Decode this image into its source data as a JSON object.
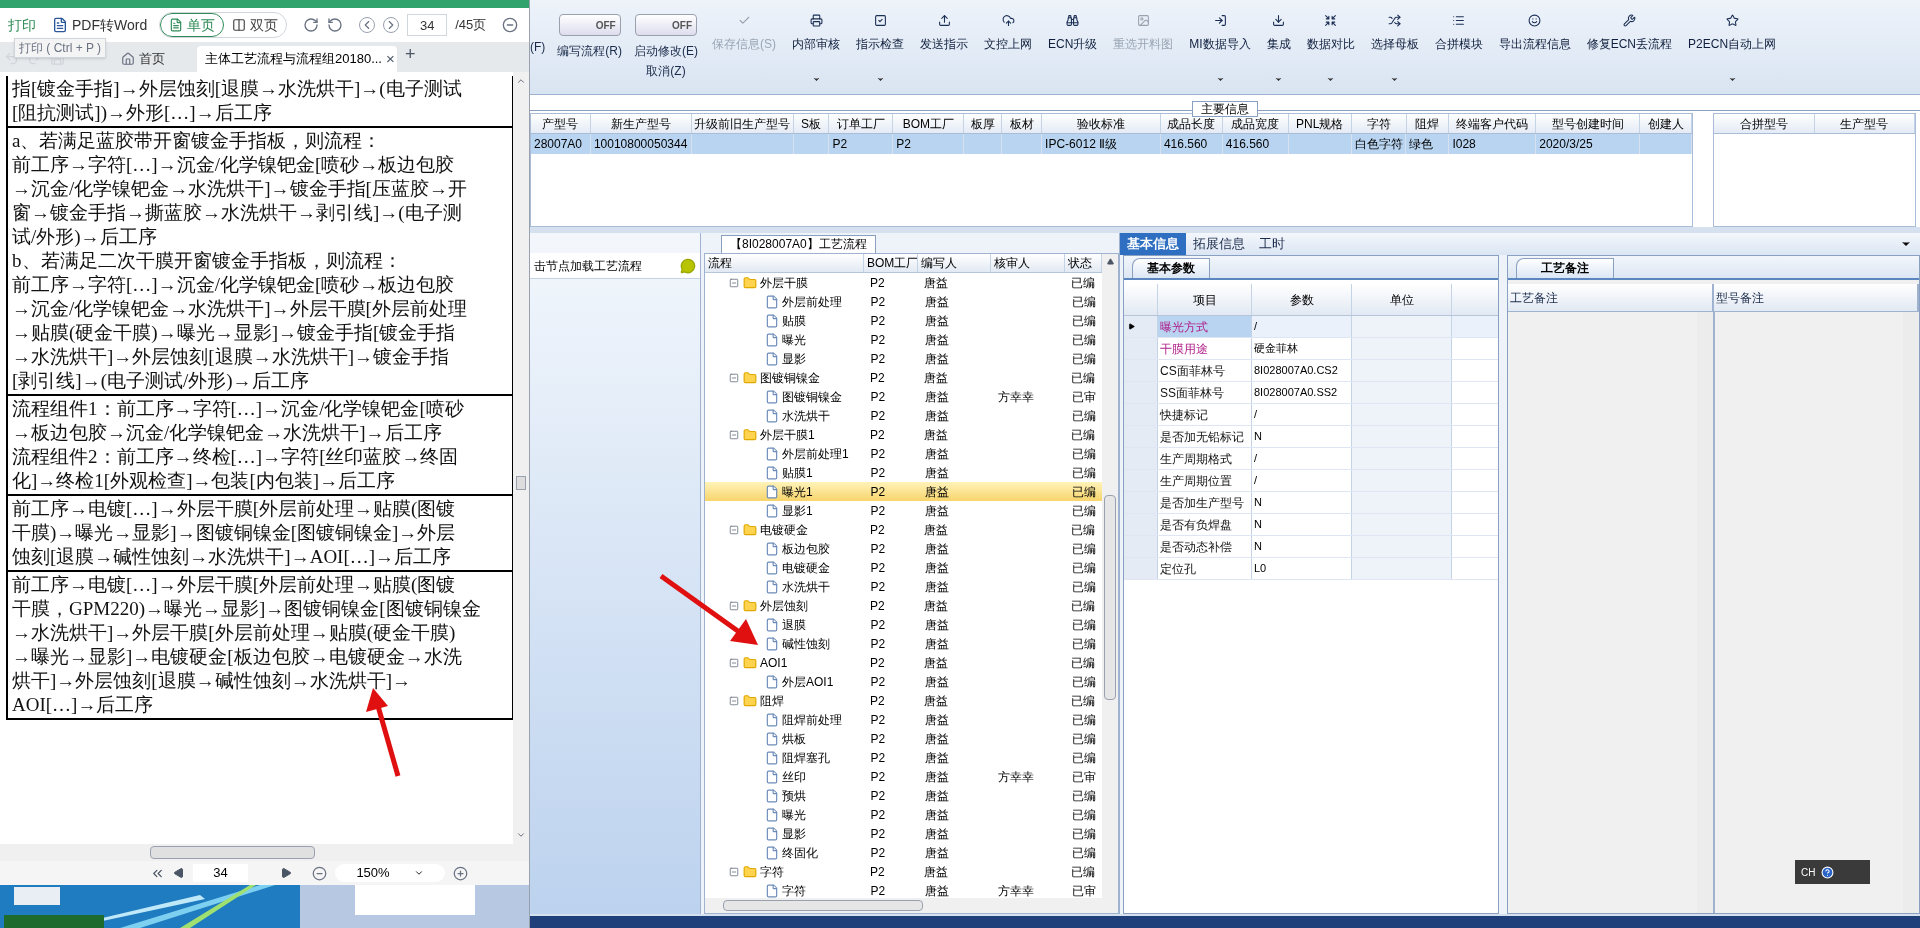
{
  "pdf_viewer": {
    "toolbar": {
      "print": "打印",
      "to_word": "PDF转Word",
      "view_modes": [
        {
          "label": "单页",
          "selected": true
        },
        {
          "label": "双页",
          "selected": false
        }
      ],
      "page": "34",
      "page_total": "/45页"
    },
    "tooltip": "打印 ( Ctrl + P )",
    "tabs": [
      {
        "label": "首页",
        "selected": false
      },
      {
        "label": "主体工艺流程与流程组20180...",
        "selected": true
      }
    ],
    "close_tab": "×",
    "new_tab": "+",
    "table_rows": [
      [
        "指[镀金手指]→外层蚀刻[退膜→水洗烘干]→(电子测试",
        "[阻抗测试])→外形[…]→后工序"
      ],
      [
        "a、若满足蓝胶带开窗镀金手指板，则流程：",
        "前工序→字符[…]→沉金/化学镍钯金[喷砂→板边包胶",
        "→沉金/化学镍钯金→水洗烘干]→镀金手指[压蓝胶→开",
        "窗→镀金手指→撕蓝胶→水洗烘干→剥引线]→(电子测",
        "试/外形)→后工序",
        "b、若满足二次干膜开窗镀金手指板，则流程：",
        "前工序→字符[…]→沉金/化学镍钯金[喷砂→板边包胶",
        "→沉金/化学镍钯金→水洗烘干]→外层干膜[外层前处理",
        "→贴膜(硬金干膜)→曝光→显影]→镀金手指[镀金手指",
        "→水洗烘干]→外层蚀刻[退膜→水洗烘干]→镀金手指",
        "[剥引线]→(电子测试/外形)→后工序"
      ],
      [
        "流程组件1：前工序→字符[…]→沉金/化学镍钯金[喷砂",
        "→板边包胶→沉金/化学镍钯金→水洗烘干]→后工序",
        "流程组件2：前工序→终检[…]→字符[丝印蓝胶→终固",
        "化]→终检1[外观检查]→包装[内包装]→后工序"
      ],
      [
        "前工序→电镀[…]→外层干膜[外层前处理→贴膜(图镀",
        "干膜)→曝光→显影]→图镀铜镍金[图镀铜镍金]→外层",
        "蚀刻[退膜→碱性蚀刻→水洗烘干]→AOI[…]→后工序"
      ],
      [
        "前工序→电镀[…]→外层干膜[外层前处理→贴膜(图镀",
        "干膜，GPM220)→曝光→显影]→图镀铜镍金[图镀铜镍金",
        "→水洗烘干]→外层干膜[外层前处理→贴膜(硬金干膜)",
        "→曝光→显影]→电镀硬金[板边包胶→电镀硬金→水洗",
        "烘干]→外层蚀刻[退膜→碱性蚀刻→水洗烘干]→",
        "AOI[…]→后工序"
      ]
    ],
    "footer": {
      "page": "34",
      "zoom": "150%"
    }
  },
  "app": {
    "toolbar": {
      "edge_label": "(F)",
      "switches": [
        {
          "text": "OFF",
          "label": "编写流程(R)",
          "on": false
        },
        {
          "text": "OFF",
          "label": "启动修改(E)",
          "on": false
        }
      ],
      "cancel_label": "取消(Z)",
      "buttons": [
        {
          "label": "保存信息(S)",
          "disabled": true,
          "dropdown": false
        },
        {
          "label": "内部审核",
          "disabled": false,
          "dropdown": true
        },
        {
          "label": "指示检查",
          "disabled": false,
          "dropdown": true
        },
        {
          "label": "发送指示",
          "disabled": false,
          "dropdown": false
        },
        {
          "label": "文控上网",
          "disabled": false,
          "dropdown": false
        },
        {
          "label": "ECN升级",
          "disabled": false,
          "dropdown": false
        },
        {
          "label": "重选开料图",
          "disabled": true,
          "dropdown": false
        },
        {
          "label": "MI数据导入",
          "disabled": false,
          "dropdown": true
        },
        {
          "label": "集成",
          "disabled": false,
          "dropdown": true
        },
        {
          "label": "数据对比",
          "disabled": false,
          "dropdown": true
        },
        {
          "label": "选择母板",
          "disabled": false,
          "dropdown": true
        },
        {
          "label": "合拼模块",
          "disabled": false,
          "dropdown": false
        },
        {
          "label": "导出流程信息",
          "disabled": false,
          "dropdown": false
        },
        {
          "label": "修复ECN丢流程",
          "disabled": false,
          "dropdown": false
        },
        {
          "label": "P2ECN自动上网",
          "disabled": false,
          "dropdown": true
        }
      ]
    },
    "main_info": {
      "title": "主要信息",
      "columns": [
        "产型号",
        "新生产型号",
        "升级前旧生产型号",
        "S板",
        "订单工厂",
        "BOM工厂",
        "板厚",
        "板材",
        "验收标准",
        "成品长度",
        "成品宽度",
        "PNL规格",
        "字符",
        "阻焊",
        "终端客户代码",
        "型号创建时间",
        "创建人"
      ],
      "rows": [
        {
          "selected": true,
          "cells": [
            "28007A0",
            "10010800050344",
            null,
            null,
            "P2",
            "P2",
            null,
            null,
            "IPC-6012 Ⅱ级",
            "416.560",
            "416.560",
            null,
            "白色字符",
            "绿色",
            "I028",
            "2020/3/25",
            null
          ]
        }
      ],
      "side_columns": [
        "合拼型号",
        "生产型号"
      ]
    },
    "load_hint": "击节点加载工艺流程",
    "flow": {
      "tab": "【8I028007A0】工艺流程",
      "columns": [
        "流程",
        "BOM工厂",
        "编写人",
        "核审人",
        "状态"
      ],
      "nodes": [
        {
          "name": "外层干膜",
          "bom": "P2",
          "writer": "唐益",
          "status": "已编",
          "selected": false,
          "expanded": true,
          "children": [
            {
              "name": "外层前处理",
              "bom": "P2",
              "writer": "唐益",
              "status": "已编",
              "selected": false
            },
            {
              "name": "贴膜",
              "bom": "P2",
              "writer": "唐益",
              "status": "已编",
              "selected": false
            },
            {
              "name": "曝光",
              "bom": "P2",
              "writer": "唐益",
              "status": "已编",
              "selected": false
            },
            {
              "name": "显影",
              "bom": "P2",
              "writer": "唐益",
              "status": "已编",
              "selected": false
            }
          ]
        },
        {
          "name": "图镀铜镍金",
          "bom": "P2",
          "writer": "唐益",
          "status": "已编",
          "selected": false,
          "expanded": true,
          "children": [
            {
              "name": "图镀铜镍金",
              "bom": "P2",
              "writer": "唐益",
              "reviewer": "方幸幸",
              "status": "已审",
              "selected": false
            },
            {
              "name": "水洗烘干",
              "bom": "P2",
              "writer": "唐益",
              "status": "已编",
              "selected": false
            }
          ]
        },
        {
          "name": "外层干膜1",
          "bom": "P2",
          "writer": "唐益",
          "status": "已编",
          "selected": false,
          "expanded": true,
          "children": [
            {
              "name": "外层前处理1",
              "bom": "P2",
              "writer": "唐益",
              "status": "已编",
              "selected": false
            },
            {
              "name": "贴膜1",
              "bom": "P2",
              "writer": "唐益",
              "status": "已编",
              "selected": false
            },
            {
              "name": "曝光1",
              "bom": "P2",
              "writer": "唐益",
              "status": "已编",
              "selected": true
            },
            {
              "name": "显影1",
              "bom": "P2",
              "writer": "唐益",
              "status": "已编",
              "selected": false
            }
          ]
        },
        {
          "name": "电镀硬金",
          "bom": "P2",
          "writer": "唐益",
          "status": "已编",
          "selected": false,
          "expanded": true,
          "children": [
            {
              "name": "板边包胶",
              "bom": "P2",
              "writer": "唐益",
              "status": "已编",
              "selected": false
            },
            {
              "name": "电镀硬金",
              "bom": "P2",
              "writer": "唐益",
              "status": "已编",
              "selected": false
            },
            {
              "name": "水洗烘干",
              "bom": "P2",
              "writer": "唐益",
              "status": "已编",
              "selected": false
            }
          ]
        },
        {
          "name": "外层蚀刻",
          "bom": "P2",
          "writer": "唐益",
          "status": "已编",
          "selected": false,
          "expanded": true,
          "children": [
            {
              "name": "退膜",
              "bom": "P2",
              "writer": "唐益",
              "status": "已编",
              "selected": false
            },
            {
              "name": "碱性蚀刻",
              "bom": "P2",
              "writer": "唐益",
              "status": "已编",
              "selected": false
            }
          ]
        },
        {
          "name": "AOI1",
          "bom": "P2",
          "writer": "唐益",
          "status": "已编",
          "selected": false,
          "expanded": true,
          "children": [
            {
              "name": "外层AOI1",
              "bom": "P2",
              "writer": "唐益",
              "status": "已编",
              "selected": false
            }
          ]
        },
        {
          "name": "阻焊",
          "bom": "P2",
          "writer": "唐益",
          "status": "已编",
          "selected": false,
          "expanded": true,
          "children": [
            {
              "name": "阻焊前处理",
              "bom": "P2",
              "writer": "唐益",
              "status": "已编",
              "selected": false
            },
            {
              "name": "烘板",
              "bom": "P2",
              "writer": "唐益",
              "status": "已编",
              "selected": false
            },
            {
              "name": "阻焊塞孔",
              "bom": "P2",
              "writer": "唐益",
              "status": "已编",
              "selected": false
            },
            {
              "name": "丝印",
              "bom": "P2",
              "writer": "唐益",
              "reviewer": "方幸幸",
              "status": "已审",
              "selected": false
            },
            {
              "name": "预烘",
              "bom": "P2",
              "writer": "唐益",
              "status": "已编",
              "selected": false
            },
            {
              "name": "曝光",
              "bom": "P2",
              "writer": "唐益",
              "status": "已编",
              "selected": false
            },
            {
              "name": "显影",
              "bom": "P2",
              "writer": "唐益",
              "status": "已编",
              "selected": false
            },
            {
              "name": "终固化",
              "bom": "P2",
              "writer": "唐益",
              "status": "已编",
              "selected": false
            }
          ]
        },
        {
          "name": "字符",
          "bom": "P2",
          "writer": "唐益",
          "status": "已编",
          "selected": false,
          "expanded": true,
          "children": [
            {
              "name": "字符",
              "bom": "P2",
              "writer": "唐益",
              "reviewer": "方幸幸",
              "status": "已审",
              "selected": false
            }
          ]
        }
      ]
    },
    "detail": {
      "tabs": [
        {
          "label": "基本信息",
          "selected": true
        },
        {
          "label": "拓展信息",
          "selected": false
        },
        {
          "label": "工时",
          "selected": false
        }
      ],
      "params": {
        "tab": "基本参数",
        "columns": [
          "项目",
          "参数",
          "单位"
        ],
        "rows": [
          {
            "item": "曝光方式",
            "value": "/",
            "highlight": true,
            "selected": true
          },
          {
            "item": "干膜用途",
            "value": "硬金菲林",
            "highlight": true,
            "selected": false
          },
          {
            "item": "CS面菲林号",
            "value": "8I028007A0.CS2",
            "highlight": false,
            "selected": false
          },
          {
            "item": "SS面菲林号",
            "value": "8I028007A0.SS2",
            "highlight": false,
            "selected": false
          },
          {
            "item": "快捷标记",
            "value": "/",
            "highlight": false,
            "selected": false
          },
          {
            "item": "是否加无铅标记",
            "value": "N",
            "highlight": false,
            "selected": false
          },
          {
            "item": "生产周期格式",
            "value": "/",
            "highlight": false,
            "selected": false
          },
          {
            "item": "生产周期位置",
            "value": "/",
            "highlight": false,
            "selected": false
          },
          {
            "item": "是否加生产型号",
            "value": "N",
            "highlight": false,
            "selected": false
          },
          {
            "item": "是否有负焊盘",
            "value": "N",
            "highlight": false,
            "selected": false
          },
          {
            "item": "是否动态补偿",
            "value": "N",
            "highlight": false,
            "selected": false
          },
          {
            "item": "定位孔",
            "value": "L0",
            "highlight": false,
            "selected": false
          }
        ]
      },
      "remarks": {
        "tab": "工艺备注",
        "columns": [
          "工艺备注",
          "型号备注"
        ]
      }
    },
    "ime": {
      "label": "CH"
    }
  }
}
